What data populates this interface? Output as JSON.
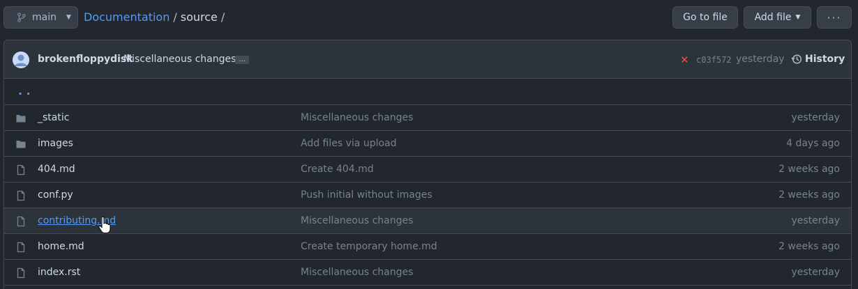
{
  "branch": {
    "name": "main",
    "icon": "git-branch-icon"
  },
  "breadcrumb": {
    "repo": "Documentation",
    "sep1": "/",
    "dir": "source",
    "sep2": "/"
  },
  "actions": {
    "go_to_file": "Go to file",
    "add_file": "Add file",
    "more": "···"
  },
  "commit": {
    "author": "brokenfloppydisk",
    "message": "Miscellaneous changes",
    "ellipsis": "…",
    "status_icon": "x-icon",
    "status_color": "#e5534b",
    "sha": "c03f572",
    "time": "yesterday",
    "history_label": "History"
  },
  "parent": {
    "label": ". ."
  },
  "files": [
    {
      "type": "folder",
      "name": "_static",
      "message": "Miscellaneous changes",
      "age": "yesterday"
    },
    {
      "type": "folder",
      "name": "images",
      "message": "Add files via upload",
      "age": "4 days ago"
    },
    {
      "type": "file",
      "name": "404.md",
      "message": "Create 404.md",
      "age": "2 weeks ago"
    },
    {
      "type": "file",
      "name": "conf.py",
      "message": "Push initial without images",
      "age": "2 weeks ago"
    },
    {
      "type": "file",
      "name": "contributing.md",
      "message": "Miscellaneous changes",
      "age": "yesterday",
      "hovered": true
    },
    {
      "type": "file",
      "name": "home.md",
      "message": "Create temporary home.md",
      "age": "2 weeks ago"
    },
    {
      "type": "file",
      "name": "index.rst",
      "message": "Miscellaneous changes",
      "age": "yesterday"
    }
  ],
  "colors": {
    "background": "#22272e",
    "accent": "#539bf5",
    "muted": "#768390"
  }
}
